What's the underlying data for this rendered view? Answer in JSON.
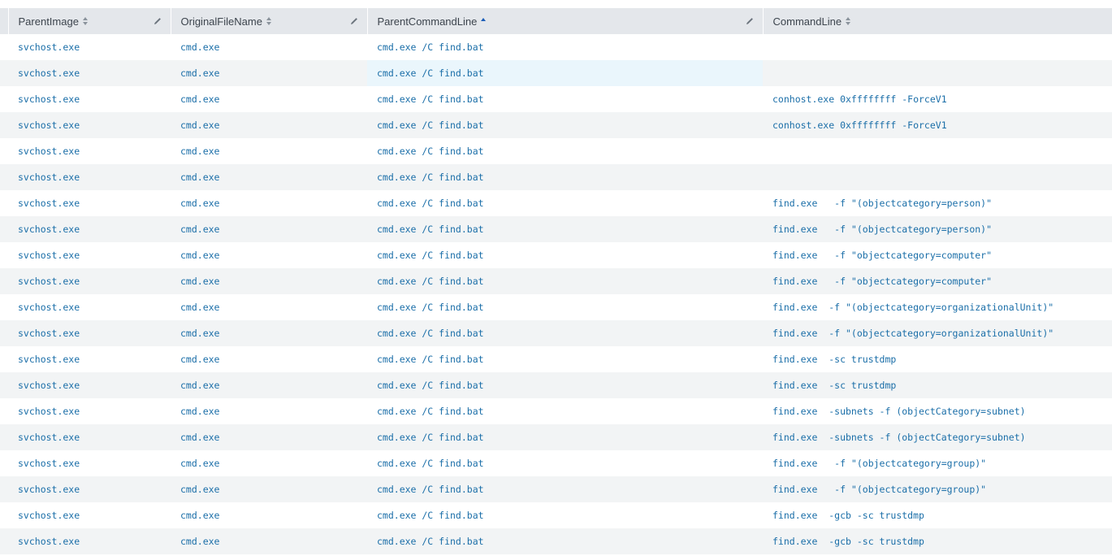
{
  "table": {
    "columns": [
      {
        "label": "ParentImage",
        "sort": "both",
        "editable": true
      },
      {
        "label": "OriginalFileName",
        "sort": "both",
        "editable": true
      },
      {
        "label": "ParentCommandLine",
        "sort": "asc",
        "editable": true
      },
      {
        "label": "CommandLine",
        "sort": "both",
        "editable": false
      }
    ],
    "rows": [
      [
        "svchost.exe",
        "cmd.exe",
        "cmd.exe /C find.bat",
        ""
      ],
      [
        "svchost.exe",
        "cmd.exe",
        "cmd.exe /C find.bat",
        ""
      ],
      [
        "svchost.exe",
        "cmd.exe",
        "cmd.exe /C find.bat",
        "conhost.exe 0xffffffff -ForceV1"
      ],
      [
        "svchost.exe",
        "cmd.exe",
        "cmd.exe /C find.bat",
        "conhost.exe 0xffffffff -ForceV1"
      ],
      [
        "svchost.exe",
        "cmd.exe",
        "cmd.exe /C find.bat",
        ""
      ],
      [
        "svchost.exe",
        "cmd.exe",
        "cmd.exe /C find.bat",
        ""
      ],
      [
        "svchost.exe",
        "cmd.exe",
        "cmd.exe /C find.bat",
        "find.exe   -f \"(objectcategory=person)\""
      ],
      [
        "svchost.exe",
        "cmd.exe",
        "cmd.exe /C find.bat",
        "find.exe   -f \"(objectcategory=person)\""
      ],
      [
        "svchost.exe",
        "cmd.exe",
        "cmd.exe /C find.bat",
        "find.exe   -f \"objectcategory=computer\""
      ],
      [
        "svchost.exe",
        "cmd.exe",
        "cmd.exe /C find.bat",
        "find.exe   -f \"objectcategory=computer\""
      ],
      [
        "svchost.exe",
        "cmd.exe",
        "cmd.exe /C find.bat",
        "find.exe  -f \"(objectcategory=organizationalUnit)\""
      ],
      [
        "svchost.exe",
        "cmd.exe",
        "cmd.exe /C find.bat",
        "find.exe  -f \"(objectcategory=organizationalUnit)\""
      ],
      [
        "svchost.exe",
        "cmd.exe",
        "cmd.exe /C find.bat",
        "find.exe  -sc trustdmp"
      ],
      [
        "svchost.exe",
        "cmd.exe",
        "cmd.exe /C find.bat",
        "find.exe  -sc trustdmp"
      ],
      [
        "svchost.exe",
        "cmd.exe",
        "cmd.exe /C find.bat",
        "find.exe  -subnets -f (objectCategory=subnet)"
      ],
      [
        "svchost.exe",
        "cmd.exe",
        "cmd.exe /C find.bat",
        "find.exe  -subnets -f (objectCategory=subnet)"
      ],
      [
        "svchost.exe",
        "cmd.exe",
        "cmd.exe /C find.bat",
        "find.exe   -f \"(objectcategory=group)\""
      ],
      [
        "svchost.exe",
        "cmd.exe",
        "cmd.exe /C find.bat",
        "find.exe   -f \"(objectcategory=group)\""
      ],
      [
        "svchost.exe",
        "cmd.exe",
        "cmd.exe /C find.bat",
        "find.exe  -gcb -sc trustdmp"
      ],
      [
        "svchost.exe",
        "cmd.exe",
        "cmd.exe /C find.bat",
        "find.exe  -gcb -sc trustdmp"
      ]
    ],
    "highlighted_cell": {
      "row": 1,
      "column": 2
    }
  },
  "colors": {
    "header_bg": "#e4e7eb",
    "header_text": "#3c444d",
    "link_text": "#1a6ea8",
    "row_alt_bg": "#f2f4f5",
    "highlight_bg": "#eaf6fc",
    "sort_active": "#1a5db8"
  },
  "icons": {
    "sort": "sort-both-icon",
    "sort_active": "sort-ascending-icon",
    "edit": "pencil-icon"
  }
}
